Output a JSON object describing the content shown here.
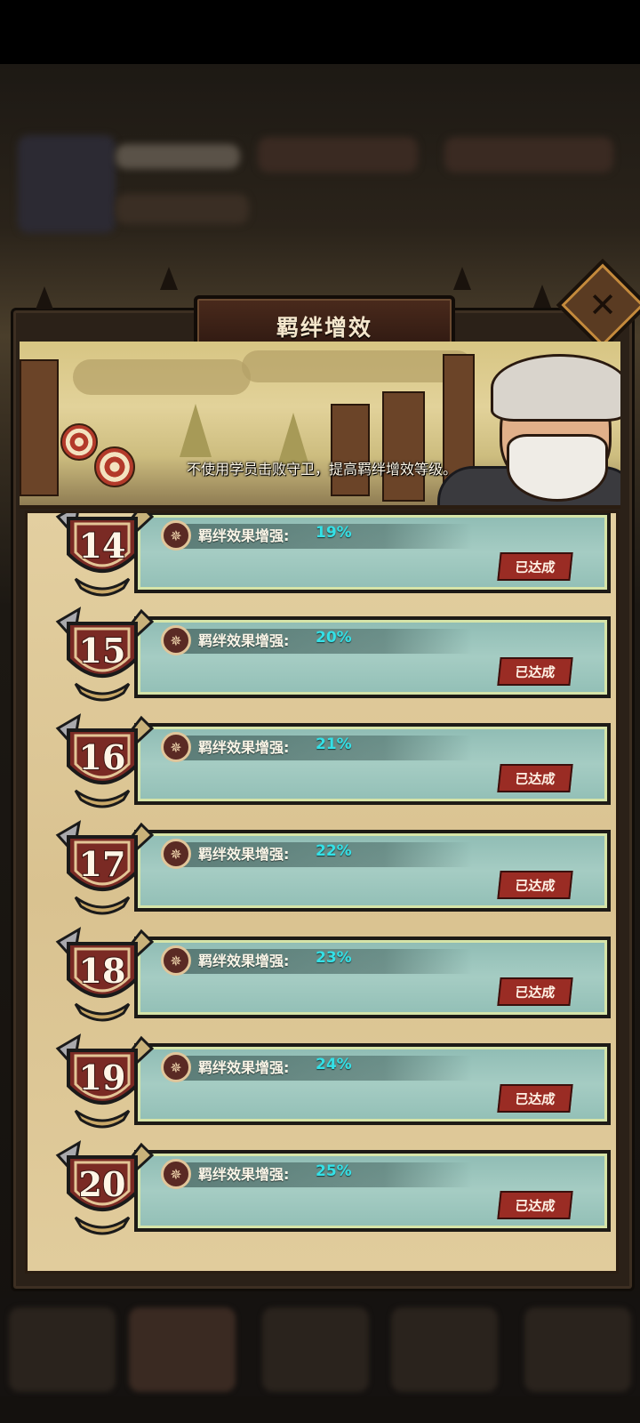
{
  "popup": {
    "title": "羁绊增效",
    "close_label": "✕",
    "banner_text": "不使用学员击败守卫，提高羁绊增效等级。"
  },
  "rows": [
    {
      "level": "14",
      "label": "羁绊效果增强:",
      "value": "19%",
      "status": "已达成"
    },
    {
      "level": "15",
      "label": "羁绊效果增强:",
      "value": "20%",
      "status": "已达成"
    },
    {
      "level": "16",
      "label": "羁绊效果增强:",
      "value": "21%",
      "status": "已达成"
    },
    {
      "level": "17",
      "label": "羁绊效果增强:",
      "value": "22%",
      "status": "已达成"
    },
    {
      "level": "18",
      "label": "羁绊效果增强:",
      "value": "23%",
      "status": "已达成"
    },
    {
      "level": "19",
      "label": "羁绊效果增强:",
      "value": "24%",
      "status": "已达成"
    },
    {
      "level": "20",
      "label": "羁绊效果增强:",
      "value": "25%",
      "status": "已达成"
    }
  ],
  "colors": {
    "value_text": "#34e0e6",
    "status_button": "#9a2c24",
    "row_background": "#a5ccc3"
  }
}
